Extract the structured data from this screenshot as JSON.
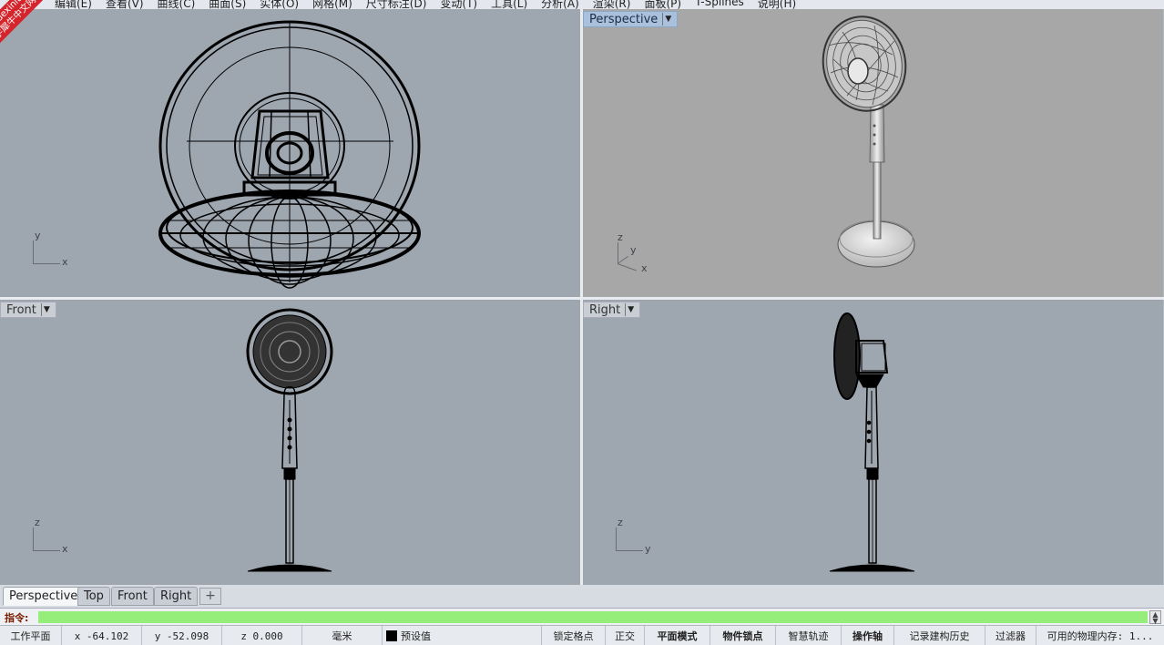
{
  "menu": [
    "编辑(E)",
    "查看(V)",
    "曲线(C)",
    "曲面(S)",
    "实体(O)",
    "网格(M)",
    "尺寸标注(D)",
    "变动(T)",
    "工具(L)",
    "分析(A)",
    "渲染(R)",
    "面板(P)",
    "T-Splines",
    "说明(H)"
  ],
  "watermark": "学犀牛中文网",
  "watermark_en": "xuexiniu",
  "viewports": {
    "top": {
      "axis_x": "x",
      "axis_y": "y"
    },
    "perspective": {
      "label": "Perspective",
      "axis_x": "x",
      "axis_y": "y",
      "axis_z": "z"
    },
    "front": {
      "label": "Front",
      "axis_x": "x",
      "axis_z": "z"
    },
    "right": {
      "label": "Right",
      "axis_y": "y",
      "axis_z": "z"
    }
  },
  "tabs": [
    "Perspective",
    "Top",
    "Front",
    "Right"
  ],
  "tab_add_icon": "+",
  "command": {
    "prompt": "指令:",
    "value": ""
  },
  "status": {
    "cplane": "工作平面",
    "x": "x -64.102",
    "y": "y -52.098",
    "z": "z 0.000",
    "units": "毫米",
    "layer": "预设值",
    "snap": "锁定格点",
    "ortho": "正交",
    "planar": "平面模式",
    "osnap": "物件锁点",
    "smarttrack": "智慧轨迹",
    "gumball": "操作轴",
    "history": "记录建构历史",
    "filter": "过滤器",
    "memory": "可用的物理内存: 1..."
  },
  "colors": {
    "viewport_bg": "#9ea6b0",
    "perspective_bg": "#a7a7a7",
    "command_field": "#95ee7a",
    "watermark": "#d5242b"
  }
}
